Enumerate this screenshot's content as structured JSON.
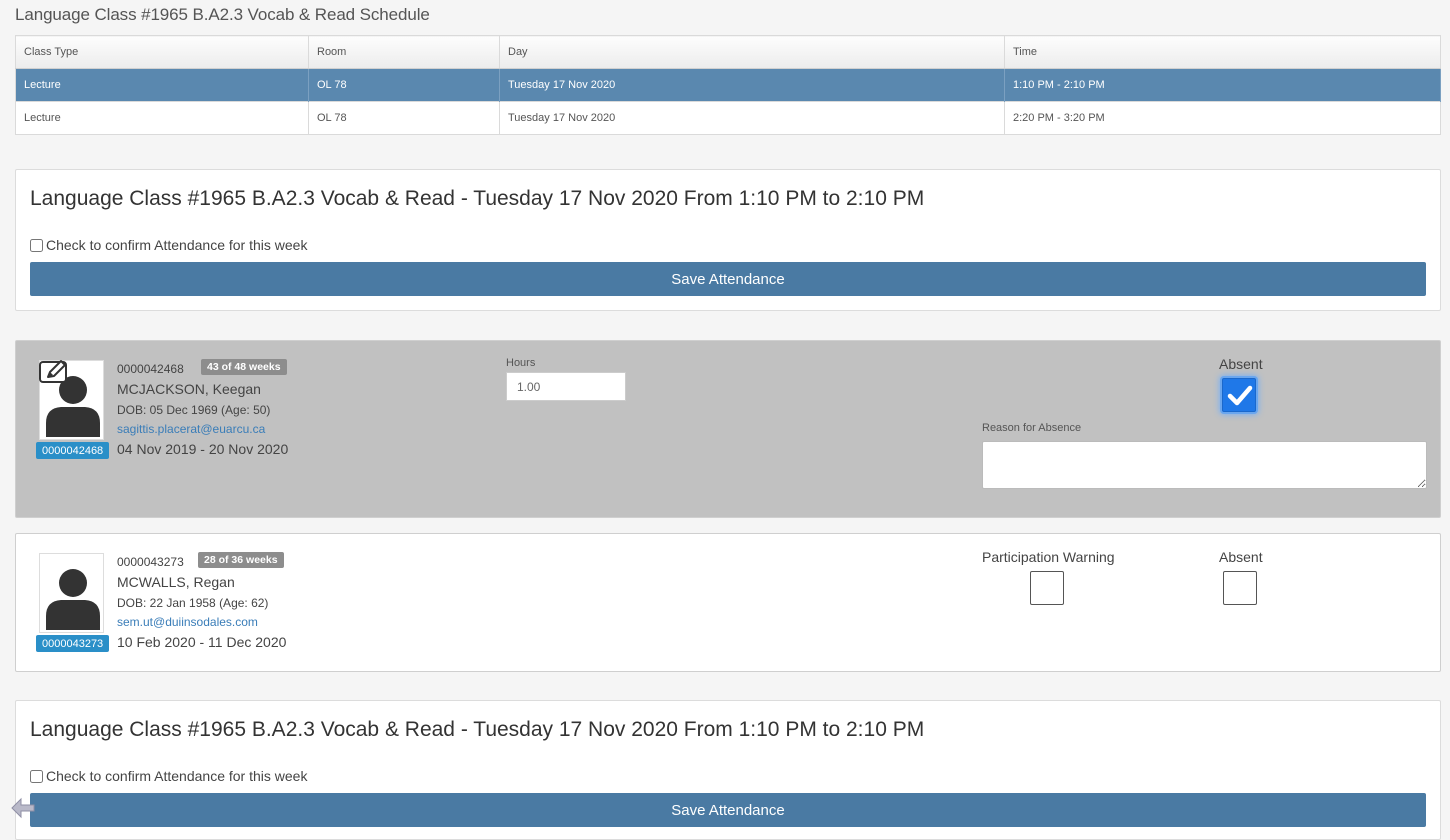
{
  "schedule": {
    "title": "Language Class #1965 B.A2.3 Vocab & Read Schedule",
    "columns": [
      "Class Type",
      "Room",
      "Day",
      "Time"
    ],
    "rows": [
      {
        "type": "Lecture",
        "room": "OL 78",
        "day": "Tuesday 17 Nov 2020",
        "time": "1:10 PM - 2:10 PM",
        "selected": true
      },
      {
        "type": "Lecture",
        "room": "OL 78",
        "day": "Tuesday 17 Nov 2020",
        "time": "2:20 PM - 3:20 PM",
        "selected": false
      }
    ]
  },
  "attendance_top": {
    "heading": "Language Class #1965 B.A2.3 Vocab & Read - Tuesday 17 Nov 2020 From 1:10 PM to 2:10 PM",
    "confirm_label": "Check to confirm Attendance for this week",
    "save_label": "Save Attendance"
  },
  "students": [
    {
      "id": "0000042468",
      "weeks": "43 of 48 weeks",
      "name": "MCJACKSON, Keegan",
      "dob": "DOB: 05 Dec 1969 (Age: 50)",
      "email": "sagittis.placerat@euarcu.ca",
      "dates": "04 Nov 2019 - 20 Nov 2020",
      "hours_label": "Hours",
      "hours_value": "1.00",
      "absent_label": "Absent",
      "absent": true,
      "reason_label": "Reason for Absence"
    },
    {
      "id": "0000043273",
      "weeks": "28 of 36 weeks",
      "name": "MCWALLS, Regan",
      "dob": "DOB: 22 Jan 1958 (Age: 62)",
      "email": "sem.ut@duiinsodales.com",
      "dates": "10 Feb 2020 - 11 Dec 2020",
      "warning_label": "Participation Warning",
      "participation_warning": false,
      "absent_label": "Absent",
      "absent": false
    }
  ],
  "attendance_bottom": {
    "heading": "Language Class #1965 B.A2.3 Vocab & Read - Tuesday 17 Nov 2020 From 1:10 PM to 2:10 PM",
    "confirm_label": "Check to confirm Attendance for this week",
    "save_label": "Save Attendance"
  },
  "colors": {
    "selected_row": "#5a88af",
    "save_button": "#4a7aa3",
    "id_badge": "#2a8fc8",
    "checkbox_checked": "#1f78e8"
  }
}
